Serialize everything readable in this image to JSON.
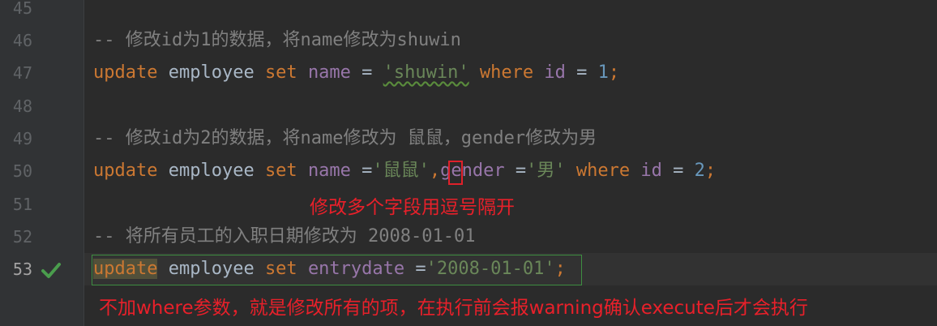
{
  "editor": {
    "line_numbers": [
      "45",
      "46",
      "47",
      "48",
      "49",
      "50",
      "51",
      "52",
      "53"
    ],
    "lines": {
      "l46": {
        "comment": "-- 修改id为1的数据，将name修改为shuwin"
      },
      "l47": {
        "kw_update": "update",
        "table": " employee ",
        "kw_set": "set",
        "col": "name",
        "eq": " = ",
        "str": "'shuwin'",
        "kw_where": "where",
        "col2": "id",
        "eq2": " = ",
        "num": "1",
        "semi": ";"
      },
      "l49": {
        "comment": "-- 修改id为2的数据，将name修改为 鼠鼠，gender修改为男"
      },
      "l50": {
        "kw_update": "update",
        "table": " employee ",
        "kw_set": "set",
        "col": "name",
        "eq": " =",
        "str": "'鼠鼠'",
        "comma": ",",
        "col_b": "gender",
        "eq_b": " =",
        "str_b": "'男'",
        "kw_where": "where",
        "col2": "id",
        "eq2": " = ",
        "num": "2",
        "semi": ";"
      },
      "l52": {
        "comment": "-- 将所有员工的入职日期修改为 2008-01-01"
      },
      "l53": {
        "kw_update": "update",
        "table": " employee ",
        "kw_set": "set",
        "col": "entrydate",
        "eq": " =",
        "str": "'2008-01-01'",
        "semi": ";"
      }
    }
  },
  "annotations": {
    "comma_note": "修改多个字段用逗号隔开",
    "where_note": "不加where参数，就是修改所有的项，在执行前会报warning确认execute后才会执行"
  },
  "icons": {
    "run_status": "checkmark-icon"
  },
  "colors": {
    "annotation": "#e8202a",
    "check": "#4a9d4d"
  }
}
